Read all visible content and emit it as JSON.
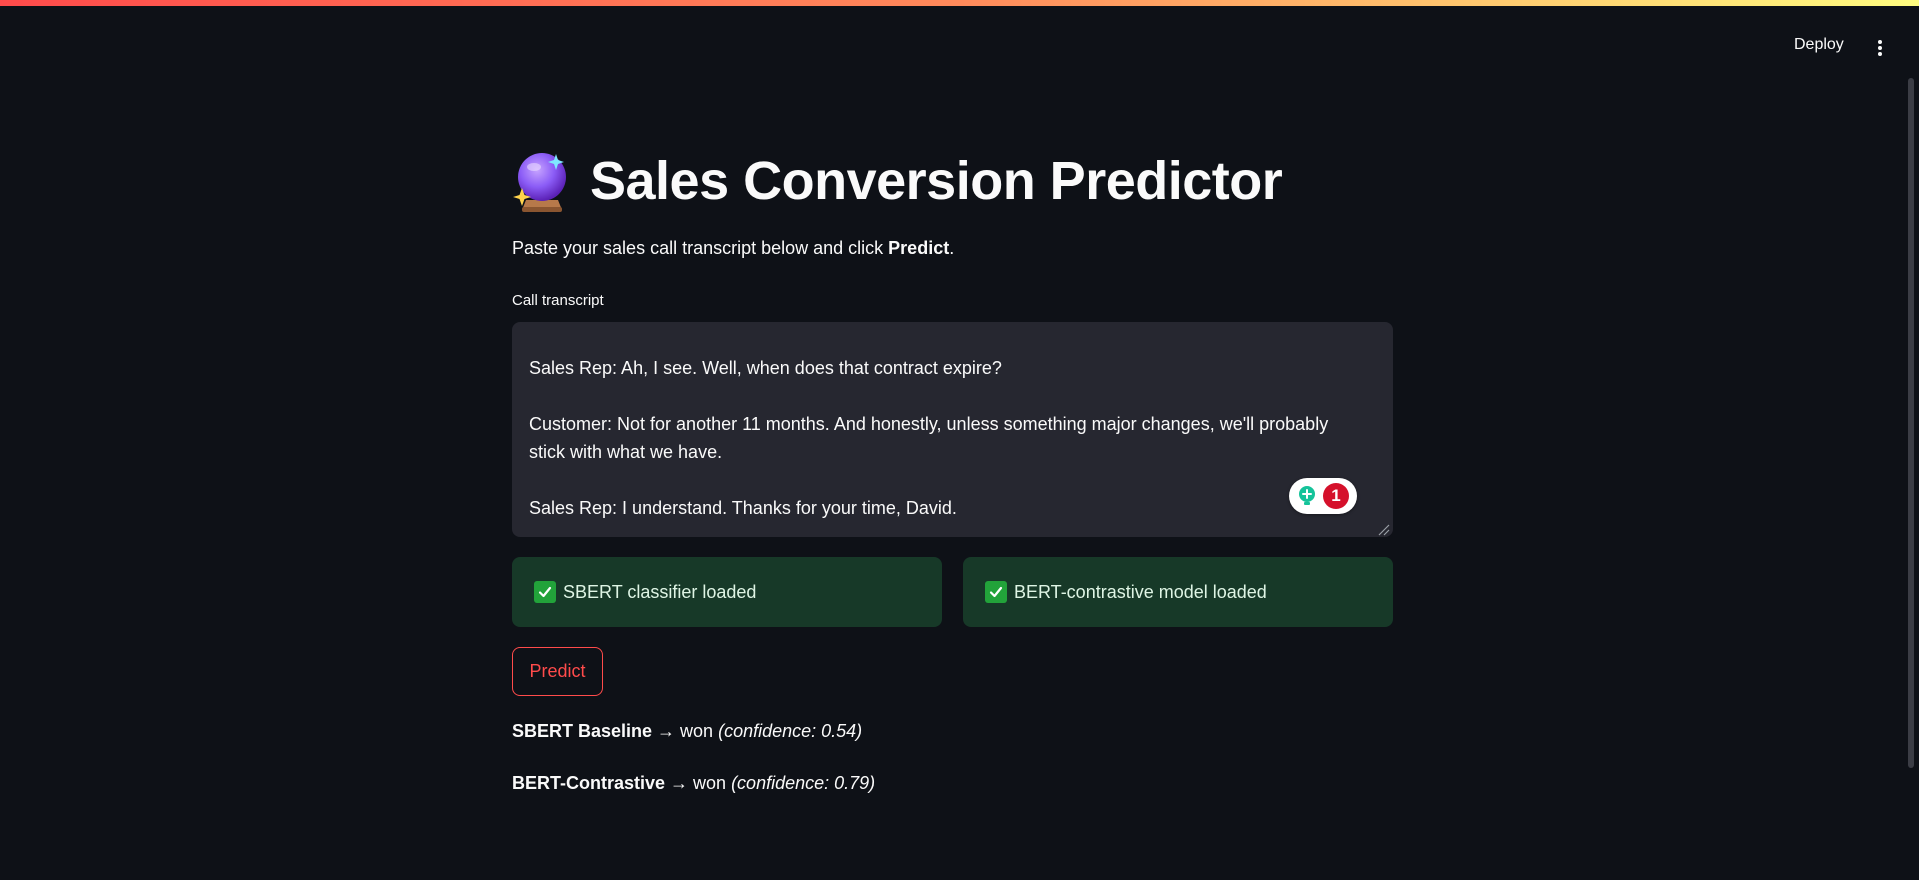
{
  "header": {
    "deploy_label": "Deploy",
    "menu_icon": "kebab-menu-icon",
    "decoration_colors": [
      "#ff4b4b",
      "#fffd80"
    ]
  },
  "title": {
    "icon": "crystal-ball-icon",
    "text": "Sales Conversion Predictor"
  },
  "intro": {
    "prefix": "Paste your sales call transcript below and click ",
    "emphasis": "Predict",
    "suffix": "."
  },
  "transcript": {
    "label": "Call transcript",
    "lines": [
      "Sales Rep: Ah, I see. Well, when does that contract expire?",
      "Customer: Not for another 11 months. And honestly, unless something major changes, we'll probably stick with what we have.",
      "Sales Rep: I understand. Thanks for your time, David."
    ],
    "grammar_badge_count": "1"
  },
  "status": {
    "left": {
      "icon": "check-icon",
      "text": "SBERT classifier loaded"
    },
    "right": {
      "icon": "check-icon",
      "text": "BERT-contrastive model loaded"
    }
  },
  "predict_button_label": "Predict",
  "results": [
    {
      "model": "SBERT Baseline",
      "arrow": " → won ",
      "confidence": "(confidence: 0.54)"
    },
    {
      "model": "BERT-Contrastive",
      "arrow": " → won ",
      "confidence": "(confidence: 0.79)"
    }
  ],
  "colors": {
    "background": "#0e1117",
    "accent": "#ff4b4b",
    "success_bg": "#173928",
    "input_bg": "#262730"
  }
}
